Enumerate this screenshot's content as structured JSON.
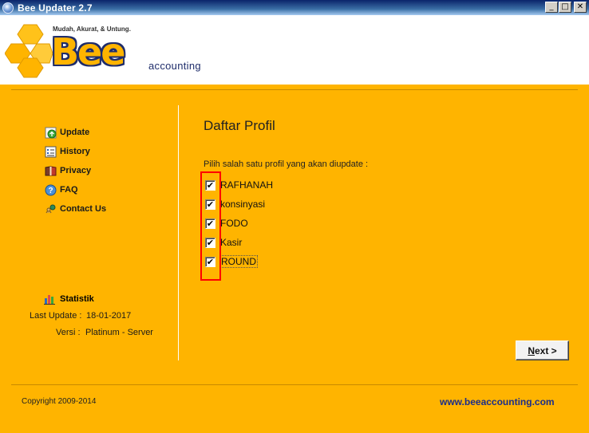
{
  "window": {
    "title": "Bee Updater 2.7",
    "controls": {
      "minimize": "_",
      "maximize": "□",
      "close": "✕"
    }
  },
  "header": {
    "tagline": "Mudah, Akurat, & Untung.",
    "brand": "Bee",
    "brand_sub": "accounting"
  },
  "sidebar": {
    "items": [
      {
        "label": "Update",
        "icon": "update-icon"
      },
      {
        "label": "History",
        "icon": "history-icon"
      },
      {
        "label": "Privacy",
        "icon": "privacy-icon"
      },
      {
        "label": "FAQ",
        "icon": "faq-icon"
      },
      {
        "label": "Contact Us",
        "icon": "contact-icon"
      }
    ],
    "statistik": {
      "label": "Statistik",
      "icon": "chart-icon"
    },
    "last_update_label": "Last Update :",
    "last_update_value": "18-01-2017",
    "versi_label": "Versi :",
    "versi_value": "Platinum - Server"
  },
  "content": {
    "title": "Daftar Profil",
    "instruction": "Pilih salah satu profil yang akan diupdate :",
    "profiles": [
      {
        "label": "RAFHANAH",
        "checked": true
      },
      {
        "label": "konsinyasi",
        "checked": true
      },
      {
        "label": "FODO",
        "checked": true
      },
      {
        "label": "Kasir",
        "checked": true
      },
      {
        "label": "ROUND",
        "checked": true
      }
    ],
    "check_mark": "✔",
    "next_button": {
      "mnemonic": "N",
      "rest": "ext >"
    }
  },
  "footer": {
    "copyright": "Copyright 2009-2014",
    "website": "www.beeaccounting.com"
  },
  "colors": {
    "background": "#ffb400",
    "title_bar": "#0a246a",
    "highlight": "#ff0000",
    "link": "#1a2d8a"
  }
}
